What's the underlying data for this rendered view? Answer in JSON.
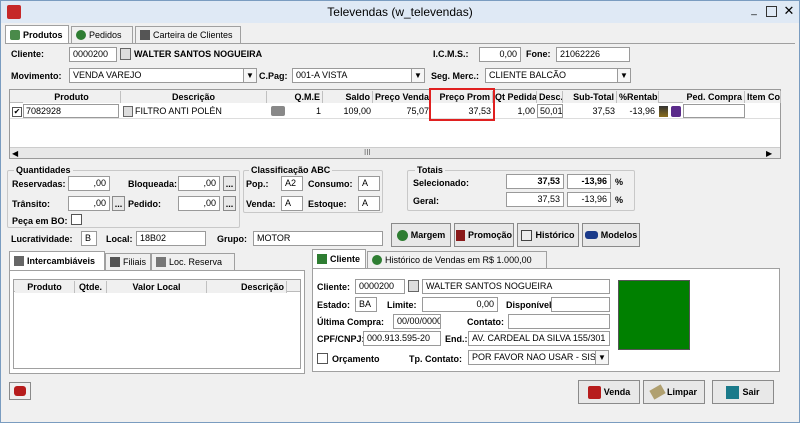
{
  "window": {
    "title": "Televendas (w_televendas)"
  },
  "tabs_top": [
    {
      "label": "Produtos"
    },
    {
      "label": "Pedidos"
    },
    {
      "label": "Carteira de Clientes"
    }
  ],
  "header": {
    "cliente_label": "Cliente:",
    "cliente_code": "0000200",
    "cliente_name": "WALTER SANTOS NOGUEIRA",
    "icms_label": "I.C.M.S.:",
    "icms_value": "0,00",
    "fone_label": "Fone:",
    "fone_value": "21062226",
    "movimento_label": "Movimento:",
    "movimento_value": "VENDA VAREJO",
    "cpag_label": "C.Pag:",
    "cpag_value": "001-A VISTA",
    "segmerc_label": "Seg. Merc.:",
    "segmerc_value": "CLIENTE BALCÃO"
  },
  "grid": {
    "columns": [
      "Produto",
      "Descrição",
      "Q.M.E",
      "Saldo",
      "Preço Venda",
      "Preço Prom",
      "Qt Pedida",
      "Desc.",
      "Sub-Total",
      "%Rentab.",
      "Ped. Compra",
      "Item Co"
    ],
    "row": {
      "produto": "7082928",
      "descricao": "FILTRO ANTI POLÉN",
      "qme": "1",
      "saldo": "109,00",
      "preco_venda": "75,07",
      "preco_prom": "37,53",
      "qt_pedida": "1,00",
      "desc": "50,01",
      "sub_total": "37,53",
      "rentab": "-13,96"
    }
  },
  "quantidades": {
    "title": "Quantidades",
    "reservadas_label": "Reservadas:",
    "reservadas": ",00",
    "bloqueada_label": "Bloqueada:",
    "bloqueada": ",00",
    "transito_label": "Trânsito:",
    "transito": ",00",
    "pedido_label": "Pedido:",
    "pedido": ",00",
    "peca_bo_label": "Peça em BO:"
  },
  "abc": {
    "title": "Classificação ABC",
    "pop_label": "Pop.:",
    "pop": "A2",
    "consumo_label": "Consumo:",
    "consumo": "A",
    "venda_label": "Venda:",
    "venda": "A",
    "estoque_label": "Estoque:",
    "estoque": "A"
  },
  "totais": {
    "title": "Totais",
    "selecionado_label": "Selecionado:",
    "selecionado": "37,53",
    "selecionado_pct": "-13,96",
    "pct1": "%",
    "geral_label": "Geral:",
    "geral": "37,53",
    "geral_pct": "-13,96",
    "pct2": "%"
  },
  "info": {
    "lucratividade_label": "Lucratividade:",
    "lucratividade": "B",
    "local_label": "Local:",
    "local": "18B02",
    "grupo_label": "Grupo:",
    "grupo": "MOTOR"
  },
  "action_buttons": {
    "margem": "Margem",
    "promocao": "Promoção",
    "historico": "Histórico",
    "modelos": "Modelos"
  },
  "lower_tabs": [
    {
      "label": "Intercambiáveis"
    },
    {
      "label": "Filiais"
    },
    {
      "label": "Loc. Reserva"
    }
  ],
  "lower_grid": {
    "columns": [
      "Produto",
      "Qtde.",
      "Valor Local",
      "Descrição"
    ]
  },
  "client_tabs": [
    {
      "label": "Cliente"
    },
    {
      "label": "Histórico de Vendas em R$ 1.000,00"
    }
  ],
  "client": {
    "cliente_label": "Cliente:",
    "code": "0000200",
    "name": "WALTER SANTOS NOGUEIRA",
    "estado_label": "Estado:",
    "estado": "BA",
    "limite_label": "Limite:",
    "limite": "0,00",
    "disponivel_label": "Disponível:",
    "disponivel": "",
    "ultima_label": "Última Compra:",
    "ultima": "00/00/0000",
    "contato_label": "Contato:",
    "contato": "",
    "cpf_label": "CPF/CNPJ:",
    "cpf": "000.913.595-20",
    "end_label": "End.:",
    "end": "AV. CARDEAL DA SILVA 155/301",
    "orcamento_label": "Orçamento",
    "tpcontato_label": "Tp. Contato:",
    "tpcontato": "POR FAVOR NAO USAR - SIST",
    "status_color": "#008000"
  },
  "footer": {
    "venda": "Venda",
    "limpar": "Limpar",
    "sair": "Sair"
  }
}
